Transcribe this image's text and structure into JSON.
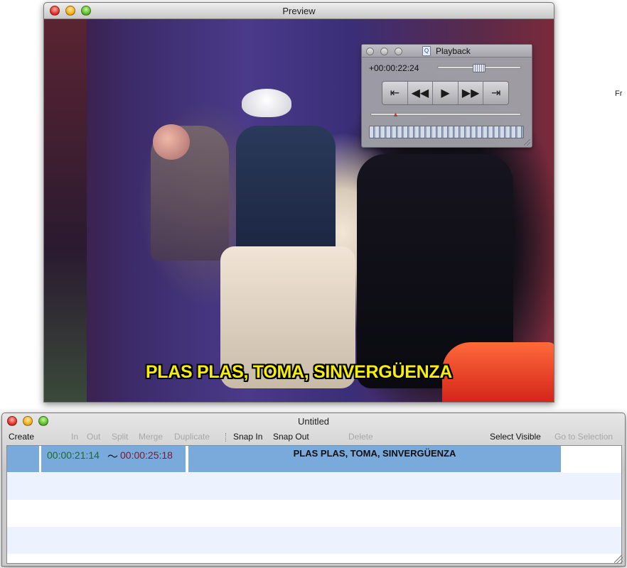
{
  "preview_window": {
    "title": "Preview",
    "subtitle_overlay": "PLAS PLAS, TOMA, SINVERGÜENZA"
  },
  "playback_panel": {
    "title": "Playback",
    "timecode": "+00:00:22:24",
    "icons": {
      "go_to_start": "skip-to-start-icon",
      "rewind": "rewind-icon",
      "play": "play-icon",
      "fast_forward": "fast-forward-icon",
      "go_to_end": "skip-to-end-icon"
    }
  },
  "right_edge_text": "Fr",
  "editor_window": {
    "title": "Untitled",
    "toolbar": {
      "create": "Create",
      "in": "In",
      "out": "Out",
      "split": "Split",
      "merge": "Merge",
      "duplicate": "Duplicate",
      "snap_in": "Snap In",
      "snap_out": "Snap Out",
      "delete": "Delete",
      "select_visible": "Select Visible",
      "go_to_selection": "Go to Selection"
    },
    "subtitles": [
      {
        "time_in": "00:00:21:14",
        "separator": "〜",
        "time_out": "00:00:25:18",
        "text": "PLAS PLAS, TOMA, SINVERGÜENZA"
      }
    ]
  },
  "colors": {
    "selection_blue": "#7aa9dc",
    "alt_row": "#edf3fe",
    "subtitle_yellow": "#f6f000",
    "time_in_green": "#1e6a2a",
    "time_out_red": "#7a1a2a"
  }
}
